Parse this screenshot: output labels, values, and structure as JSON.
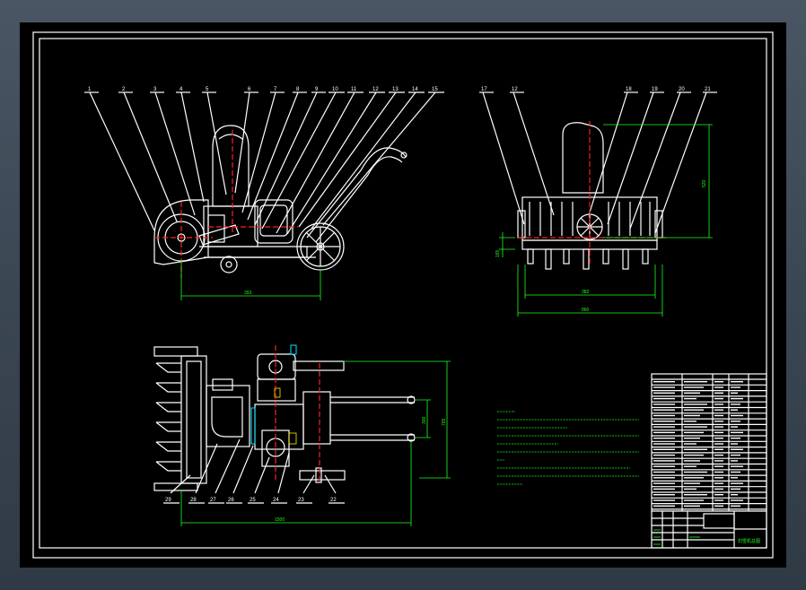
{
  "drawing": {
    "side_view_balloons": [
      "1",
      "2",
      "3",
      "4",
      "5",
      "6",
      "7",
      "8",
      "9",
      "10",
      "11",
      "12",
      "13",
      "14",
      "15"
    ],
    "front_view_balloons": [
      "17",
      "12",
      "18",
      "19",
      "20",
      "21"
    ],
    "top_view_balloons": [
      "29",
      "28",
      "27",
      "26",
      "25",
      "24",
      "23",
      "22"
    ],
    "side_view_dimension": "393",
    "front_view_dim_inner": "382",
    "front_view_dim_outer": "860",
    "front_view_dim_height": "520",
    "front_view_dim_left": "165",
    "top_view_dim_right_outer": "765",
    "top_view_dim_right_inner": "300",
    "top_view_dim_bottom": "1500",
    "title_block_name": "扫雪机总图"
  },
  "colors": {
    "background": "#000000",
    "line": "#ffffff",
    "dimension": "#19ff19",
    "centerline": "#ff2020",
    "frame_outer": "#4a5663"
  }
}
